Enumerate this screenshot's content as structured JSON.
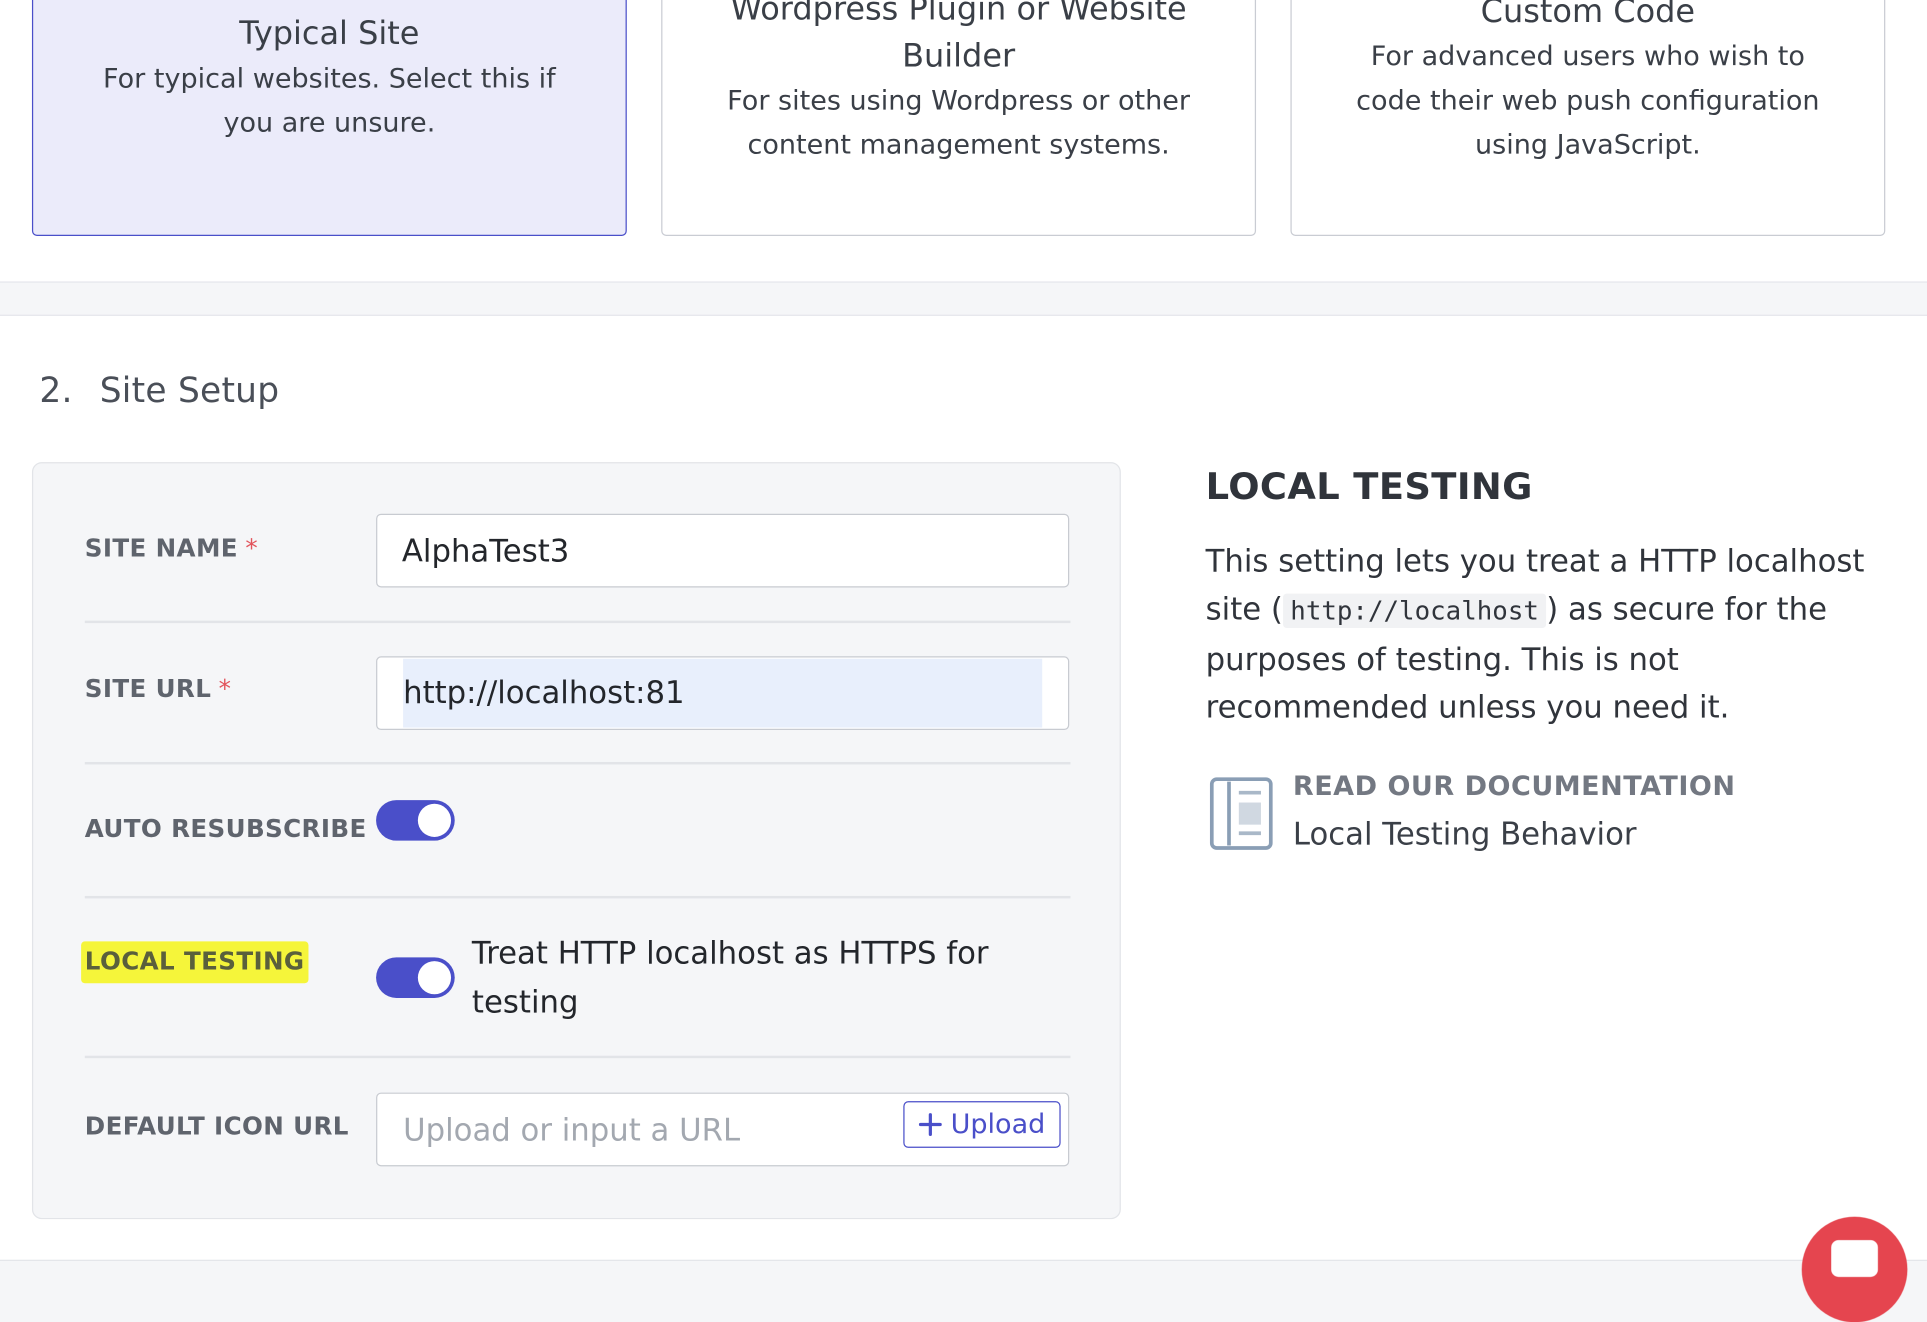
{
  "site_types": [
    {
      "title": "Typical Site",
      "desc_line1": "For typical websites. Select this if",
      "desc_line2": "you are unsure.",
      "selected": true
    },
    {
      "title_line1": "Wordpress Plugin or Website",
      "title_line2": "Builder",
      "desc_line1": "For sites using Wordpress or other",
      "desc_line2": "content management systems.",
      "selected": false
    },
    {
      "title": "Custom Code",
      "desc_line1": "For advanced users who wish to",
      "desc_line2": "code their web push configuration",
      "desc_line3": "using JavaScript.",
      "selected": false
    }
  ],
  "setup": {
    "step_number": "2.",
    "title": "Site Setup",
    "required_marker": "*",
    "fields": {
      "site_name": {
        "label": "SITE NAME",
        "value": "AlphaTest3"
      },
      "site_url": {
        "label": "SITE URL",
        "value": "http://localhost:81"
      },
      "auto_resubscribe": {
        "label": "AUTO RESUBSCRIBE",
        "enabled": true
      },
      "local_testing": {
        "label": "LOCAL TESTING",
        "enabled": true,
        "description": "Treat HTTP localhost as HTTPS for testing"
      },
      "default_icon_url": {
        "label": "DEFAULT ICON URL",
        "placeholder": "Upload or input a URL",
        "upload_label": "Upload"
      }
    }
  },
  "help": {
    "title": "LOCAL TESTING",
    "text_before_code": "This setting lets you treat a HTTP localhost site (",
    "code": "http://localhost",
    "text_after_code": ") as secure for the purposes of testing. This is not recommended unless you need it.",
    "doc_heading": "READ OUR DOCUMENTATION",
    "doc_link": "Local Testing Behavior"
  },
  "colors": {
    "accent": "#4a4fc9",
    "selected_card_bg": "#ebebfa",
    "highlight": "#f5f53a",
    "required": "#e2545c",
    "chat_bubble": "#e5454f"
  },
  "icons": {
    "upload": "plus-icon",
    "documentation": "document-icon",
    "chat": "chat-icon"
  }
}
